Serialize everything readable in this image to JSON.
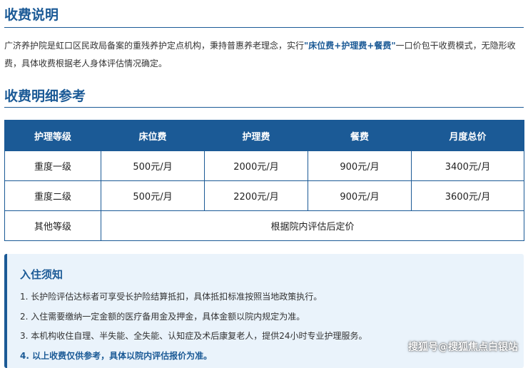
{
  "section1": {
    "title": "收费说明",
    "intro_part1": "广济养护院是虹口区民政局备案的重残养护定点机构，秉持普惠养老理念，实行",
    "intro_highlight": "\"床位费+护理费+餐费\"",
    "intro_part2": "一口价包干收费模式，无隐形收费，具体收费根据老人身体评估情况确定。"
  },
  "section2": {
    "title": "收费明细参考"
  },
  "fee_table": {
    "headers": [
      "护理等级",
      "床位费",
      "护理费",
      "餐费",
      "月度总价"
    ],
    "rows": [
      [
        "重度一级",
        "500元/月",
        "2000元/月",
        "900元/月",
        "3400元/月"
      ],
      [
        "重度二级",
        "500元/月",
        "2200元/月",
        "900元/月",
        "3600元/月"
      ]
    ],
    "other_row": {
      "level": "其他等级",
      "note": "根据院内评估后定价"
    }
  },
  "notice": {
    "title": "入住须知",
    "items": [
      "1. 长护险评估达标者可享受长护险结算抵扣，具体抵扣标准按照当地政策执行。",
      "2. 入住需要缴纳一定金额的医疗备用金及押金，具体金额以院内规定为准。",
      "3. 本机构收住自理、半失能、全失能、认知症及术后康复老人，提供24小时专业护理服务。",
      "4. 以上收费仅供参考，具体以院内评估报价为准。"
    ]
  },
  "watermark": "搜狐号@搜狐焦点白银站",
  "colors": {
    "accent": "#1b5a96",
    "notice_bg": "#eaf3fb"
  }
}
